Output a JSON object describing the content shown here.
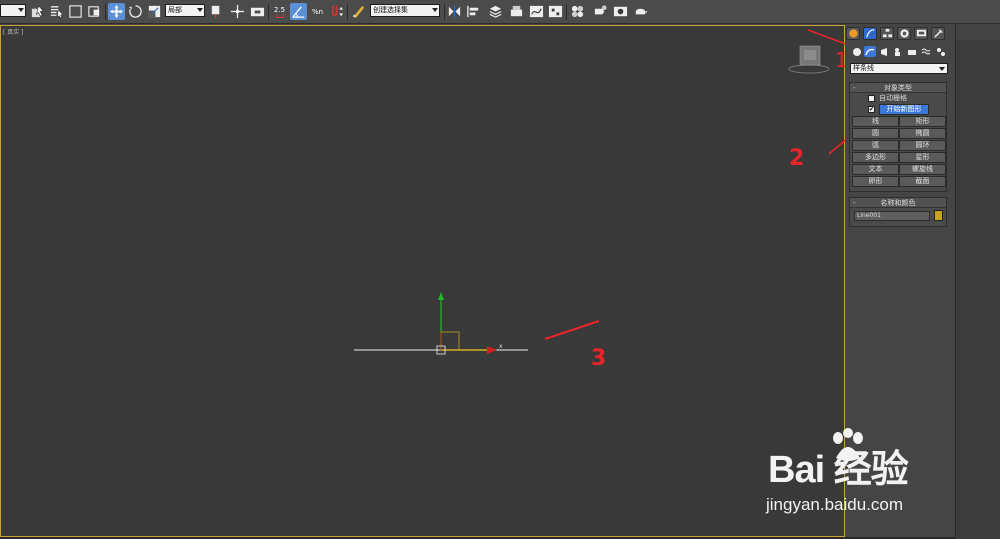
{
  "toolbar": {
    "selection_filter": "",
    "coord_system": "局部",
    "named_selection_set": "创建选择集",
    "snap_label": "2.5",
    "percent_label": "%n"
  },
  "viewport": {
    "label": "[ 真实 ]",
    "axis_x_label": "x"
  },
  "command_panel": {
    "category_dropdown": "样条线",
    "object_type_title": "对象类型",
    "auto_grid_label": "自动栅格",
    "start_new_shape_label": "开始新图形",
    "start_new_shape_checked": "✔",
    "shape_buttons": [
      "线",
      "矩形",
      "圆",
      "椭圆",
      "弧",
      "圆环",
      "多边形",
      "星形",
      "文本",
      "螺旋线",
      "卵形",
      "截面"
    ],
    "name_color_title": "名称和颜色",
    "object_name": "Line001",
    "object_color": "#c8a31e"
  },
  "annotations": {
    "one": "1",
    "two": "2",
    "three": "3",
    "color": "#e8242a"
  },
  "watermark": {
    "logo_text": "Bai 经验",
    "url": "jingyan.baidu.com"
  }
}
